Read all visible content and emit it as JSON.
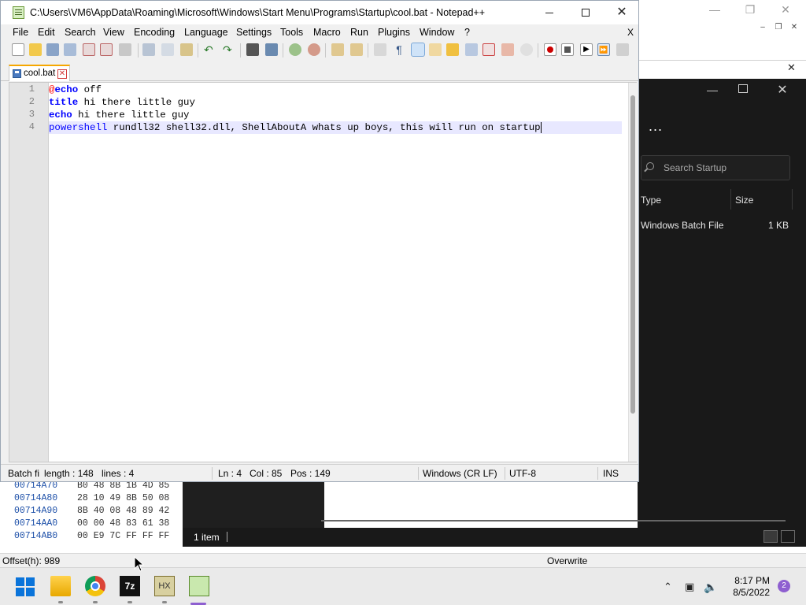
{
  "notepadpp": {
    "title": "C:\\Users\\VM6\\AppData\\Roaming\\Microsoft\\Windows\\Start Menu\\Programs\\Startup\\cool.bat - Notepad++",
    "menu": [
      "File",
      "Edit",
      "Search",
      "View",
      "Encoding",
      "Language",
      "Settings",
      "Tools",
      "Macro",
      "Run",
      "Plugins",
      "Window",
      "?"
    ],
    "menu_close_doc": "X",
    "tab": {
      "label": "cool.bat"
    },
    "line_numbers": [
      "1",
      "2",
      "3",
      "4"
    ],
    "code": {
      "line1": {
        "at": "@",
        "kw": "echo",
        "rest": " off"
      },
      "line2": {
        "kw": "title",
        "rest": " hi there little guy"
      },
      "line3": {
        "kw": "echo",
        "rest": " hi there little guy"
      },
      "line4": {
        "kw": "powershell",
        "rest": " rundll32 shell32.dll, ShellAboutA whats up boys, this will run on startup"
      }
    },
    "status": {
      "filetype": "Batch fi",
      "length": "length : 148",
      "lines": "lines : 4",
      "ln": "Ln : 4",
      "col": "Col : 85",
      "pos": "Pos : 149",
      "eol": "Windows (CR LF)",
      "encoding": "UTF-8",
      "mode": "INS"
    }
  },
  "explorer": {
    "more": "...",
    "search_placeholder": "Search Startup",
    "columns": [
      "Type",
      "Size"
    ],
    "row": {
      "type": "Windows Batch File",
      "size": "1 KB"
    },
    "item_count": "1 item"
  },
  "hex_editor": {
    "rows": [
      {
        "addr": "00714A70",
        "bytes": "B0 48 8B 1B 4D 85"
      },
      {
        "addr": "00714A80",
        "bytes": "28 10 49 8B 50 08"
      },
      {
        "addr": "00714A90",
        "bytes": "8B 40 08 48 89 42"
      },
      {
        "addr": "00714AA0",
        "bytes": "00 00 48 83 61 38"
      },
      {
        "addr": "00714AB0",
        "bytes": "00 E9 7C FF FF FF"
      }
    ],
    "offset": "Offset(h): 989",
    "mode": "Overwrite"
  },
  "taskbar": {
    "apps": [
      "File Explorer",
      "Google Chrome",
      "7-Zip",
      "HxD",
      "Notepad++"
    ],
    "seven_zip_label": "7z",
    "time": "8:17 PM",
    "date": "8/5/2022",
    "notifications": "2"
  }
}
